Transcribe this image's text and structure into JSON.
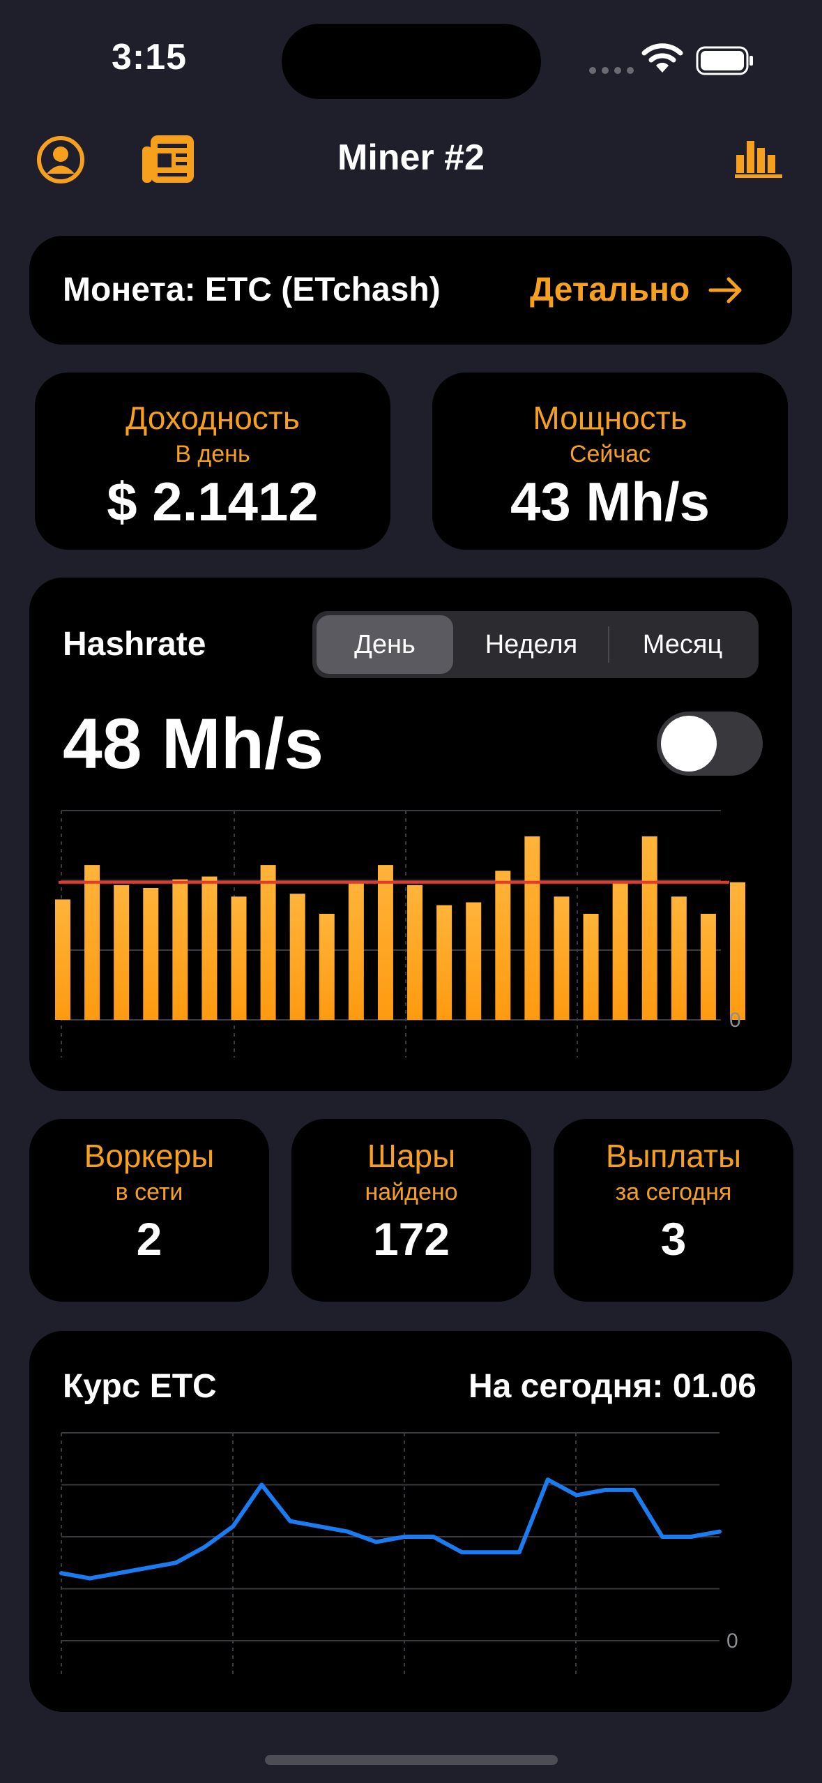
{
  "status_bar": {
    "time": "3:15"
  },
  "nav": {
    "title": "Miner #2",
    "left_icons": [
      "person-circle-icon",
      "newspaper-icon"
    ],
    "right_icon": "bar-chart-icon"
  },
  "coin": {
    "label": "Монета: ETC (ETchash)",
    "link": "Детально"
  },
  "stats_top": [
    {
      "title": "Доходность",
      "subtitle": "В день",
      "value": "$ 2.1412"
    },
    {
      "title": "Мощность",
      "subtitle": "Сейчас",
      "value": "43 Mh/s"
    }
  ],
  "hashrate": {
    "title": "Hashrate",
    "segments": [
      "День",
      "Неделя",
      "Месяц"
    ],
    "selected_segment": "День",
    "value": "48 Mh/s",
    "toggle_on": false
  },
  "stats_bottom": [
    {
      "title": "Воркеры",
      "subtitle": "в сети",
      "value": "2"
    },
    {
      "title": "Шары",
      "subtitle": "найдено",
      "value": "172"
    },
    {
      "title": "Выплаты",
      "subtitle": "за сегодня",
      "value": "3"
    }
  ],
  "rate": {
    "title": "Курс ETC",
    "date_label": "На сегодня: 01.06"
  },
  "colors": {
    "accent": "#f7a01e",
    "bar_top": "#ffb43a",
    "bar_bottom": "#ff9a10",
    "avg_line": "#e8382e",
    "rate_line": "#1a7cf0",
    "background": "#1e1f2a",
    "card": "#000000"
  },
  "chart_data": [
    {
      "type": "bar",
      "values": [
        42,
        54,
        47,
        46,
        49,
        50,
        43,
        54,
        44,
        37,
        48,
        54,
        47,
        40,
        41,
        52,
        64,
        43,
        37,
        48,
        64,
        43,
        37,
        48
      ],
      "average": 48,
      "ylim": [
        0,
        73
      ],
      "tick_labels": [
        "0"
      ],
      "grid": true
    },
    {
      "type": "line",
      "values": [
        13,
        12,
        13,
        14,
        15,
        18,
        22,
        30,
        23,
        22,
        21,
        19,
        20,
        20,
        17,
        17,
        17,
        31,
        28,
        29,
        29,
        20,
        20,
        21
      ],
      "ylim": [
        0,
        40
      ],
      "tick_labels": [
        "0"
      ],
      "grid": true
    }
  ]
}
